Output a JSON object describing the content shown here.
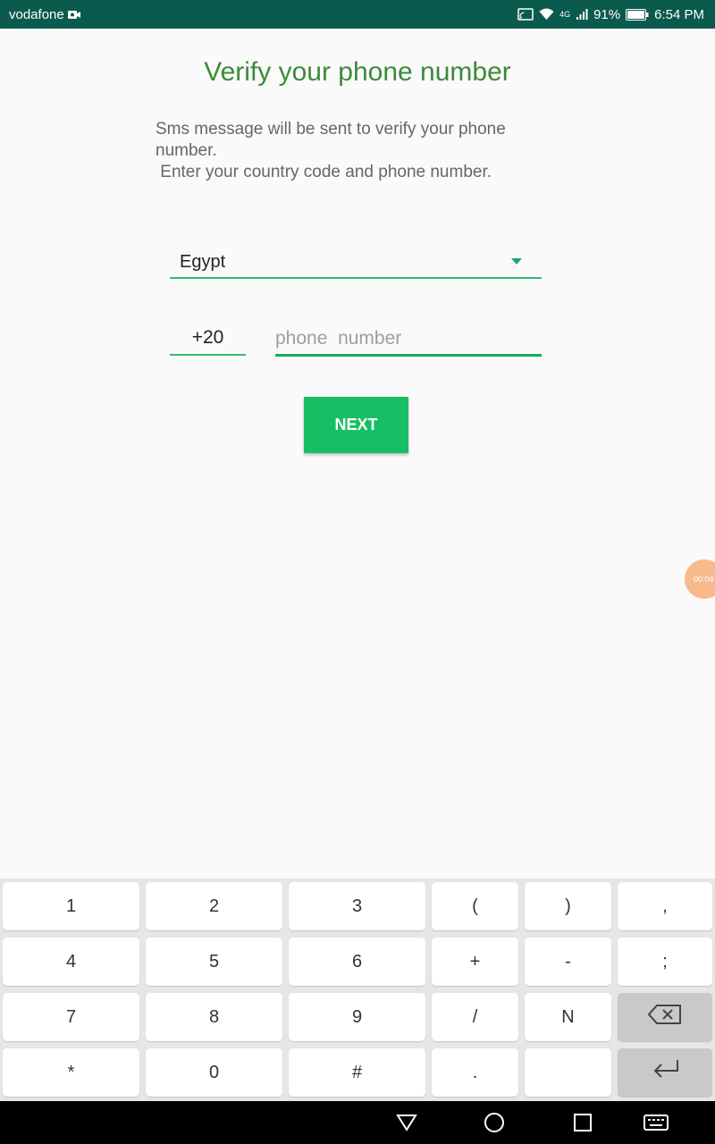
{
  "status_bar": {
    "carrier": "vodafone",
    "signal": "4G",
    "battery": "91%",
    "time": "6:54 PM"
  },
  "screen": {
    "title": "Verify your phone number",
    "description_line1": "Sms message will be sent to verify your phone",
    "description_line2": "number.",
    "description_line3": " Enter your country code and phone number.",
    "country": "Egypt",
    "country_code": "+20",
    "phone_placeholder": "phone  number",
    "phone_value": "",
    "next_label": "NEXT",
    "timer_bubble": "00:04"
  },
  "keyboard": {
    "rows": [
      [
        "1",
        "2",
        "3",
        "(",
        ")",
        ","
      ],
      [
        "4",
        "5",
        "6",
        "+",
        "-",
        ";"
      ],
      [
        "7",
        "8",
        "9",
        "/",
        "N",
        "backspace-icon"
      ],
      [
        "*",
        "0",
        "#",
        ".",
        "",
        "enter-icon"
      ]
    ]
  },
  "colors": {
    "status_bar": "#0b5a4e",
    "title": "#3d8a3a",
    "accent": "#17bf64",
    "underline": "#2ebd72"
  }
}
